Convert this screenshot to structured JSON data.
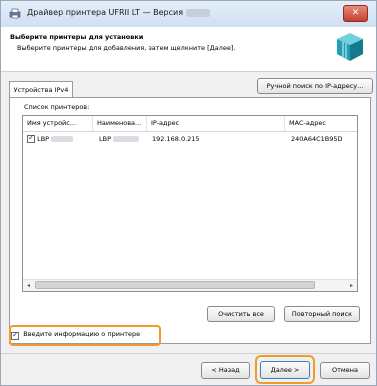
{
  "window": {
    "title": "Драйвер принтера UFRII LT — Версия",
    "close_label": "✕"
  },
  "header": {
    "title": "Выберите принтеры для установки",
    "subtitle": "Выберите принтеры для добавления, затем щелкните [Далее]."
  },
  "tabs": [
    {
      "label": "Устройства IPv4"
    }
  ],
  "buttons": {
    "manual_search": "Ручной поиск по IP-адресу...",
    "clear_all": "Очистить все",
    "research": "Повторный поиск",
    "back": "< Назад",
    "next": "Далее >",
    "cancel": "Отмена"
  },
  "list": {
    "label": "Список принтеров:",
    "columns": [
      "Имя устройс...",
      "Наименова...",
      "IP-адрес",
      "MAC-адрес"
    ],
    "rows": [
      {
        "checked": true,
        "device_name": "LBP",
        "product_name": "LBP",
        "ip": "192.168.0.215",
        "mac": "240A64C1B95D"
      }
    ]
  },
  "option": {
    "label": "Введите информацию о принтере",
    "checked": true
  },
  "colors": {
    "highlight": "#f29b2a",
    "accent": "#1d3f8a"
  }
}
